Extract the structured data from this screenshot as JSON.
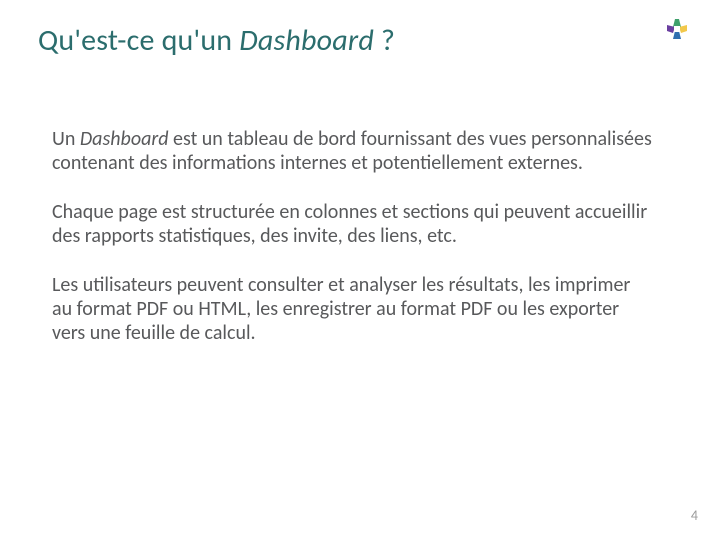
{
  "title": {
    "pre": "Qu'est-ce qu'un ",
    "em": "Dashboard",
    "post": " ?"
  },
  "paragraphs": {
    "p1_pre": "Un ",
    "p1_em": "Dashboard",
    "p1_post": " est un tableau de bord fournissant des vues personnalisées contenant des informations internes et potentiellement externes.",
    "p2": "Chaque page est structurée en colonnes et sections qui peuvent accueillir des rapports statistiques, des invite, des liens, etc.",
    "p3": "Les utilisateurs peuvent consulter et analyser les résultats, les imprimer au format PDF ou HTML, les enregistrer au format PDF ou les exporter vers une feuille de calcul."
  },
  "page_number": "4"
}
